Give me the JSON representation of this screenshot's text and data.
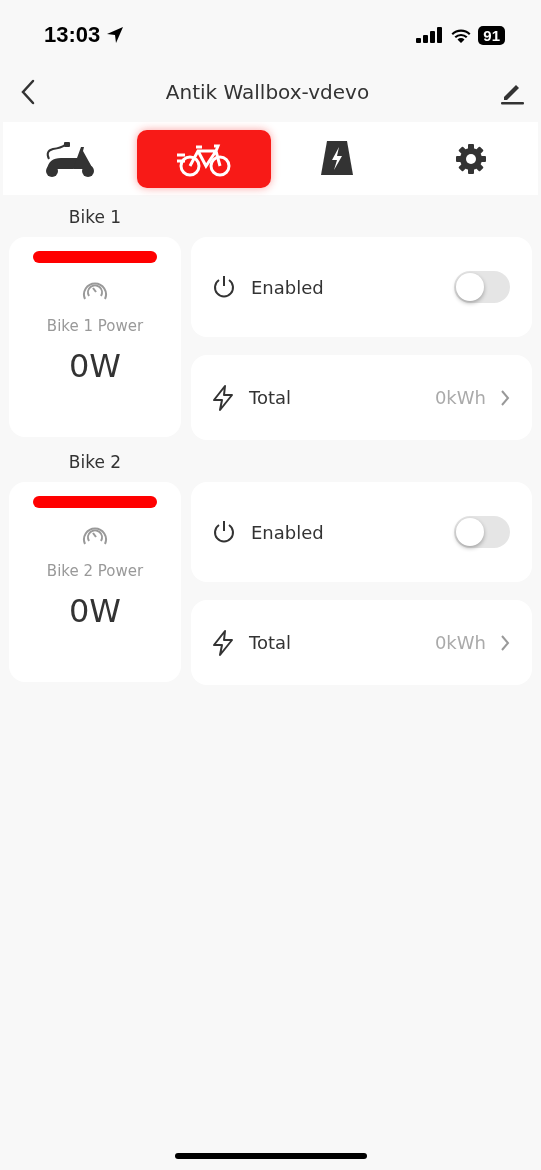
{
  "status_bar": {
    "time": "13:03",
    "battery": "91"
  },
  "header": {
    "title": "Antik Wallbox-vdevo"
  },
  "tabs": [
    {
      "kind": "scooter",
      "selected": false
    },
    {
      "kind": "bike",
      "selected": true
    },
    {
      "kind": "battery",
      "selected": false
    },
    {
      "kind": "settings",
      "selected": false
    }
  ],
  "bikes": [
    {
      "name": "Bike 1",
      "color": "#ff0000",
      "power_label": "Bike 1 Power",
      "power": "0W",
      "enabled_label": "Enabled",
      "on": false,
      "total_label": "Total",
      "total": "0kWh"
    },
    {
      "name": "Bike 2",
      "color": "#ff0000",
      "power_label": "Bike 2 Power",
      "power": "0W",
      "enabled_label": "Enabled",
      "on": false,
      "total_label": "Total",
      "total": "0kWh"
    }
  ]
}
